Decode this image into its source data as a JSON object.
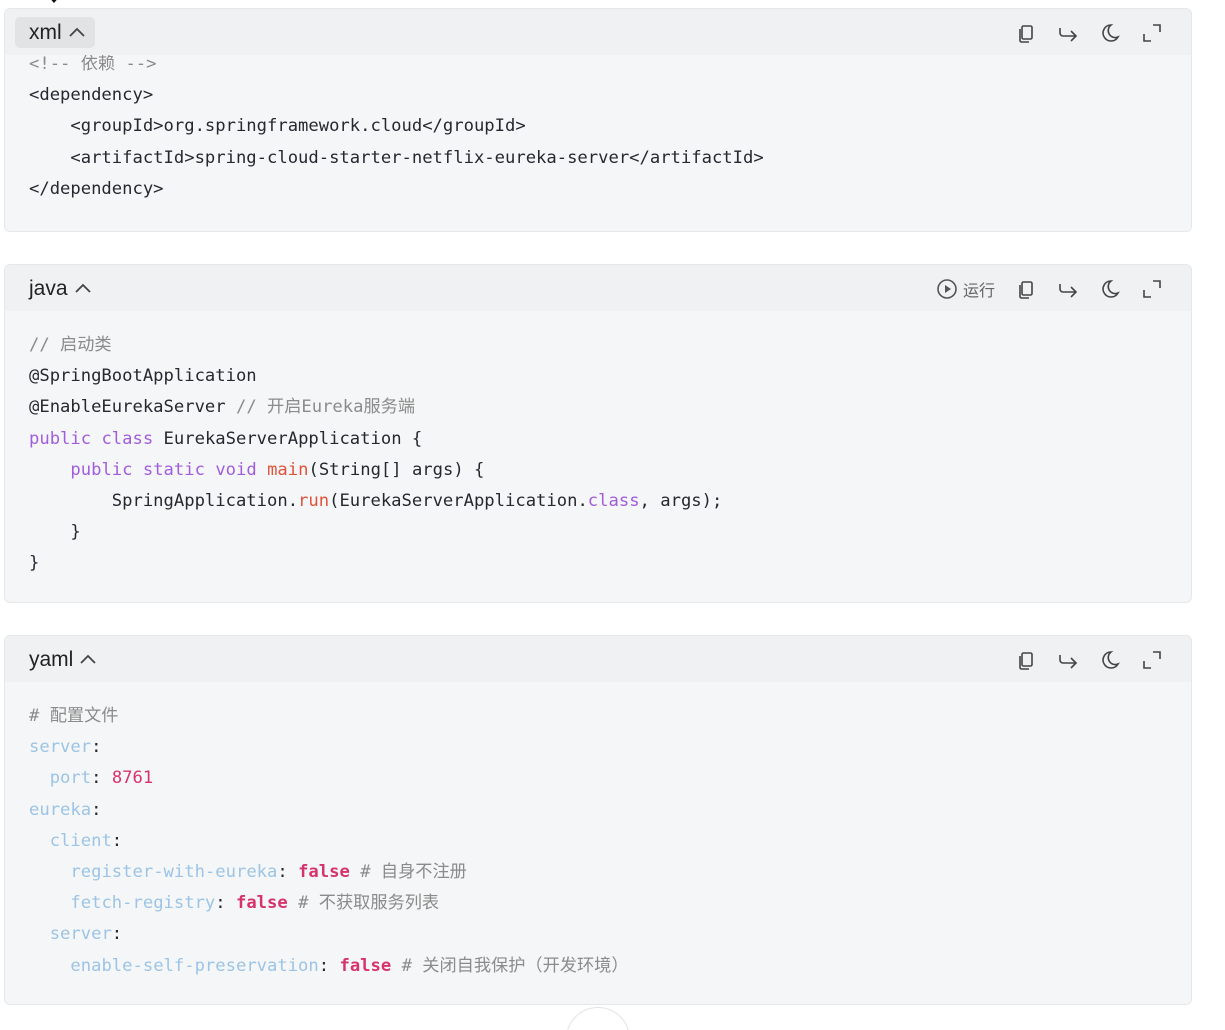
{
  "blocks": [
    {
      "lang": "xml",
      "lines": [
        [
          [
            "<!-- 依赖 -->",
            "cmt"
          ]
        ],
        [
          [
            "<dependency>",
            ""
          ]
        ],
        [
          [
            "    <groupId>org.springframework.cloud</groupId>",
            ""
          ]
        ],
        [
          [
            "    <artifactId>spring-cloud-starter-netflix-eureka-server</artifactId>",
            ""
          ]
        ],
        [
          [
            "</dependency>",
            ""
          ]
        ]
      ]
    },
    {
      "lang": "java",
      "run_label": "运行",
      "lines": [
        [
          [
            "// 启动类",
            "cmt"
          ]
        ],
        [
          [
            "@SpringBootApplication",
            ""
          ]
        ],
        [
          [
            "@EnableEurekaServer ",
            ""
          ],
          [
            "// 开启Eureka服务端",
            "cmt"
          ]
        ],
        [
          [
            "public",
            "kw"
          ],
          [
            " ",
            ""
          ],
          [
            "class",
            "kw"
          ],
          [
            " EurekaServerApplication {",
            ""
          ]
        ],
        [
          [
            "    ",
            ""
          ],
          [
            "public",
            "kw"
          ],
          [
            " ",
            ""
          ],
          [
            "static",
            "kw"
          ],
          [
            " ",
            ""
          ],
          [
            "void",
            "kw"
          ],
          [
            " ",
            ""
          ],
          [
            "main",
            "fn"
          ],
          [
            "(String[] args) {",
            ""
          ]
        ],
        [
          [
            "        SpringApplication.",
            ""
          ],
          [
            "run",
            "fn"
          ],
          [
            "(EurekaServerApplication.",
            ""
          ],
          [
            "class",
            "kw"
          ],
          [
            ", args);",
            ""
          ]
        ],
        [
          [
            "    }",
            ""
          ]
        ],
        [
          [
            "}",
            ""
          ]
        ]
      ]
    },
    {
      "lang": "yaml",
      "lines": [
        [
          [
            "# 配置文件",
            "cmt"
          ]
        ],
        [
          [
            "server",
            "key"
          ],
          [
            ":",
            ""
          ]
        ],
        [
          [
            "  ",
            ""
          ],
          [
            "port",
            "key"
          ],
          [
            ": ",
            ""
          ],
          [
            "8761",
            "num"
          ]
        ],
        [
          [
            "eureka",
            "key"
          ],
          [
            ":",
            ""
          ]
        ],
        [
          [
            "  ",
            ""
          ],
          [
            "client",
            "key"
          ],
          [
            ":",
            ""
          ]
        ],
        [
          [
            "    ",
            ""
          ],
          [
            "register-with-eureka",
            "key"
          ],
          [
            ": ",
            ""
          ],
          [
            "false",
            "bool"
          ],
          [
            " ",
            ""
          ],
          [
            "# 自身不注册",
            "cmt"
          ]
        ],
        [
          [
            "    ",
            ""
          ],
          [
            "fetch-registry",
            "key"
          ],
          [
            ": ",
            ""
          ],
          [
            "false",
            "bool"
          ],
          [
            " ",
            ""
          ],
          [
            "# 不获取服务列表",
            "cmt"
          ]
        ],
        [
          [
            "  ",
            ""
          ],
          [
            "server",
            "key"
          ],
          [
            ":",
            ""
          ]
        ],
        [
          [
            "    ",
            ""
          ],
          [
            "enable-self-preservation",
            "key"
          ],
          [
            ": ",
            ""
          ],
          [
            "false",
            "bool"
          ],
          [
            " ",
            ""
          ],
          [
            "# 关闭自我保护（开发环境）",
            "cmt"
          ]
        ]
      ]
    }
  ],
  "icons": {
    "collapse": "chevron-up-icon",
    "run": "play-circle-icon",
    "copy": "copy-icon",
    "wrap": "wrap-icon",
    "theme": "moon-icon",
    "fullscreen": "fullscreen-icon"
  },
  "colors": {
    "comment": "#8b8b8b",
    "keyword": "#a15ddd",
    "function": "#e0533a",
    "yaml_key": "#9cc4e6",
    "number": "#d6336c"
  }
}
